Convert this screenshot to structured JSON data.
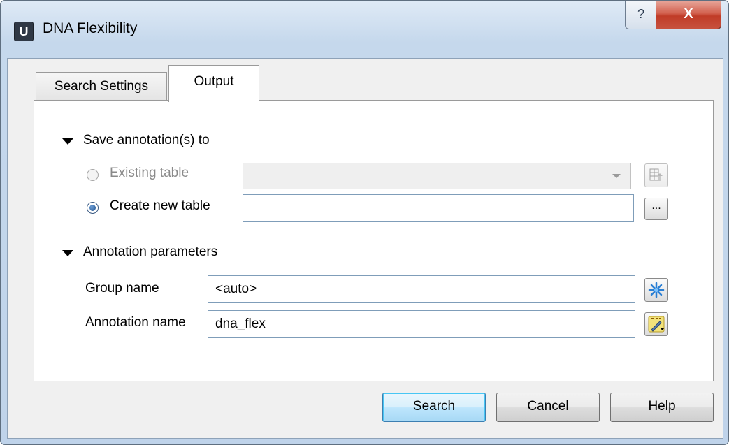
{
  "window": {
    "title": "DNA Flexibility",
    "app_icon": "U",
    "help_glyph": "?",
    "close_glyph": "X"
  },
  "tabs": [
    {
      "label": "Search Settings",
      "active": false
    },
    {
      "label": "Output",
      "active": true
    }
  ],
  "save_section": {
    "title": "Save annotation(s) to",
    "existing_table": {
      "label": "Existing table",
      "checked": false,
      "enabled": false,
      "value": ""
    },
    "create_new_table": {
      "label": "Create new table",
      "checked": true,
      "value": ""
    },
    "browse_label": "..."
  },
  "annotation_section": {
    "title": "Annotation parameters",
    "group_name": {
      "label": "Group name",
      "value": "<auto>"
    },
    "annotation_name": {
      "label": "Annotation name",
      "value": "dna_flex"
    }
  },
  "footer": {
    "search_label": "Search",
    "cancel_label": "Cancel",
    "help_label": "Help"
  },
  "colors": {
    "accent": "#3c7fb1",
    "close_red": "#c03b27",
    "title_gradient_top": "#dfeaf6"
  },
  "icons": [
    "app-u-icon",
    "help-icon",
    "close-icon",
    "collapse-arrow-icon",
    "table-select-icon",
    "browse-icon",
    "snowflake-icon",
    "abc-pencil-icon",
    "dropdown-arrow-icon"
  ]
}
